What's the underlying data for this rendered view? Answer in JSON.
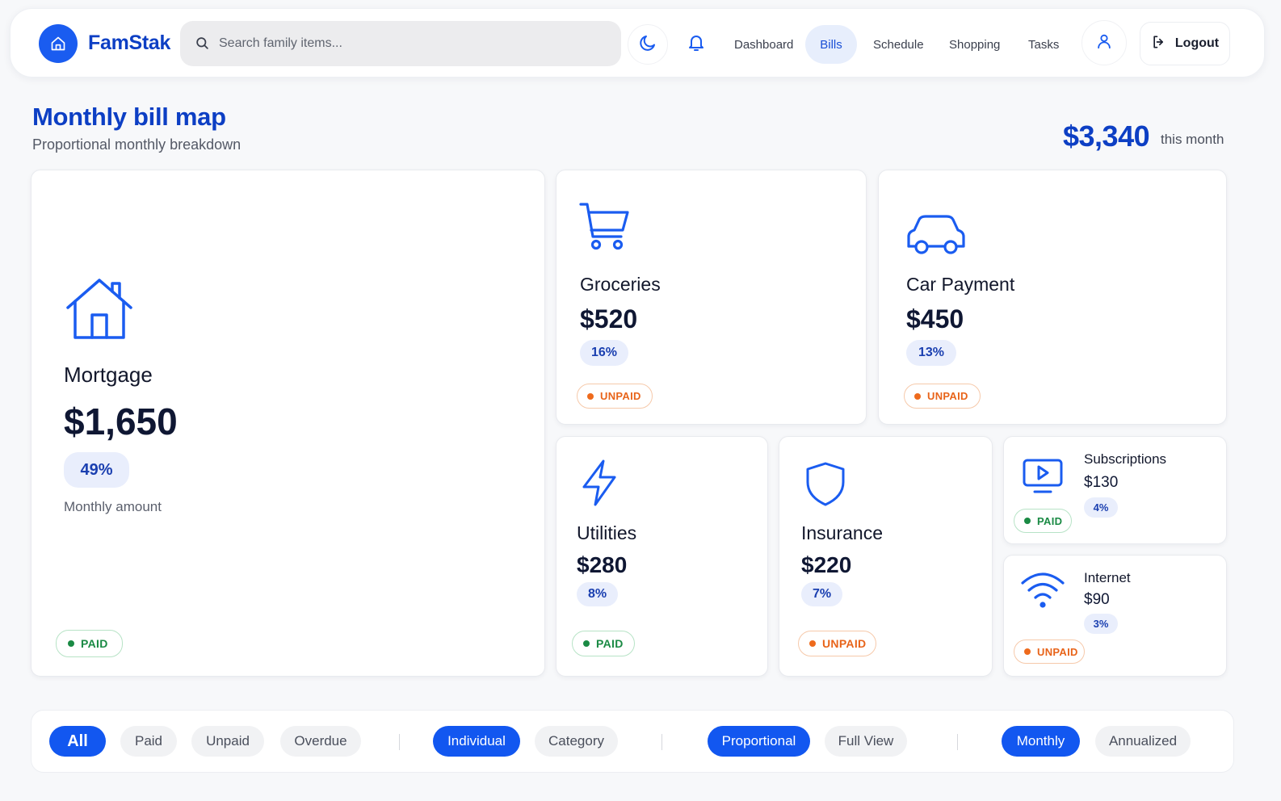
{
  "header": {
    "brand": "FamStak",
    "search_placeholder": "Search family items...",
    "nav": [
      "Dashboard",
      "Bills",
      "Schedule",
      "Shopping",
      "Tasks"
    ],
    "active_nav": "Bills",
    "logout_label": "Logout"
  },
  "page": {
    "title": "Monthly bill map",
    "subtitle": "Proportional monthly breakdown",
    "total": "$3,340",
    "total_label": "this month"
  },
  "bills": {
    "mortgage": {
      "name": "Mortgage",
      "amount": "$1,650",
      "pct": "49%",
      "note": "Monthly amount",
      "status": "PAID",
      "icon": "house-icon"
    },
    "groceries": {
      "name": "Groceries",
      "amount": "$520",
      "pct": "16%",
      "status": "UNPAID",
      "icon": "cart-icon"
    },
    "car": {
      "name": "Car Payment",
      "amount": "$450",
      "pct": "13%",
      "status": "UNPAID",
      "icon": "car-icon"
    },
    "utilities": {
      "name": "Utilities",
      "amount": "$280",
      "pct": "8%",
      "status": "PAID",
      "icon": "bolt-icon"
    },
    "insurance": {
      "name": "Insurance",
      "amount": "$220",
      "pct": "7%",
      "status": "UNPAID",
      "icon": "shield-icon"
    },
    "subscriptions": {
      "name": "Subscriptions",
      "amount": "$130",
      "pct": "4%",
      "status": "PAID",
      "icon": "monitor-play-icon"
    },
    "internet": {
      "name": "Internet",
      "amount": "$90",
      "pct": "3%",
      "status": "UNPAID",
      "icon": "wifi-icon"
    }
  },
  "filters": {
    "status": [
      "All",
      "Paid",
      "Unpaid",
      "Overdue"
    ],
    "grouping": [
      "Individual",
      "Category"
    ],
    "view": [
      "Proportional",
      "Full View"
    ],
    "period": [
      "Monthly",
      "Annualized"
    ],
    "active": [
      "All",
      "Individual",
      "Proportional",
      "Monthly"
    ]
  },
  "colors": {
    "accent": "#1257f0",
    "brand_text": "#0d3fc4",
    "paid": "#1a8a44",
    "unpaid": "#e8641a",
    "pct_bg": "#e9eefc"
  }
}
